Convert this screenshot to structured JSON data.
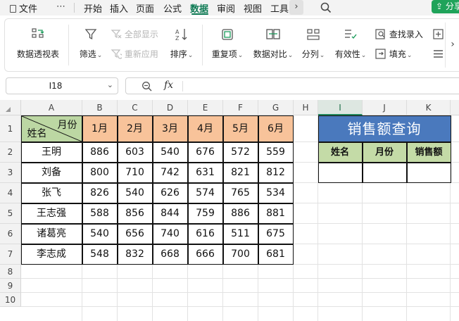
{
  "menubar": {
    "file_label": "文件",
    "more_label": "⋯",
    "tabs": [
      "开始",
      "插入",
      "页面",
      "公式",
      "数据",
      "审阅",
      "视图",
      "工具"
    ],
    "active_tab": "数据",
    "scroll_right": "›",
    "share_label": "分享"
  },
  "ribbon": {
    "pivot_table": "数据透视表",
    "filter": "筛选",
    "show_all": "全部显示",
    "reapply": "重新应用",
    "sort": "排序",
    "duplicates": "重复项",
    "compare": "数据对比",
    "split_column": "分列",
    "validity": "有效性",
    "lookup_entry": "查找录入",
    "fill": "填充",
    "scroll_right": "›"
  },
  "formula_bar": {
    "cell_ref": "I18",
    "fx": "fx",
    "formula": ""
  },
  "sheet": {
    "columns": [
      "A",
      "B",
      "C",
      "D",
      "E",
      "F",
      "G",
      "H",
      "I",
      "J",
      "K"
    ],
    "active_column": "I",
    "rows": [
      "1",
      "2",
      "3",
      "4",
      "5",
      "6",
      "7",
      "8",
      "9",
      "10"
    ],
    "header_month_label": "月份",
    "header_name_label": "姓名",
    "months": [
      "1月",
      "2月",
      "3月",
      "4月",
      "5月",
      "6月"
    ],
    "data_rows": [
      {
        "name": "王明",
        "values": [
          "886",
          "603",
          "540",
          "676",
          "572",
          "559"
        ]
      },
      {
        "name": "刘备",
        "values": [
          "800",
          "710",
          "742",
          "631",
          "821",
          "812"
        ]
      },
      {
        "name": "张飞",
        "values": [
          "826",
          "540",
          "626",
          "574",
          "765",
          "534"
        ]
      },
      {
        "name": "王志强",
        "values": [
          "588",
          "856",
          "844",
          "759",
          "886",
          "881"
        ]
      },
      {
        "name": "诸葛亮",
        "values": [
          "540",
          "656",
          "740",
          "616",
          "511",
          "675"
        ]
      },
      {
        "name": "李志成",
        "values": [
          "548",
          "832",
          "668",
          "666",
          "700",
          "681"
        ]
      }
    ],
    "lookup": {
      "title": "销售额查询",
      "headers": [
        "姓名",
        "月份",
        "销售额"
      ],
      "values": [
        "",
        "",
        ""
      ]
    }
  },
  "colors": {
    "accent": "#0f7b55",
    "month_header": "#f8c39a",
    "name_header": "#bcd7a3",
    "lookup_title": "#4a79bd",
    "lookup_header": "#c4dba7"
  }
}
